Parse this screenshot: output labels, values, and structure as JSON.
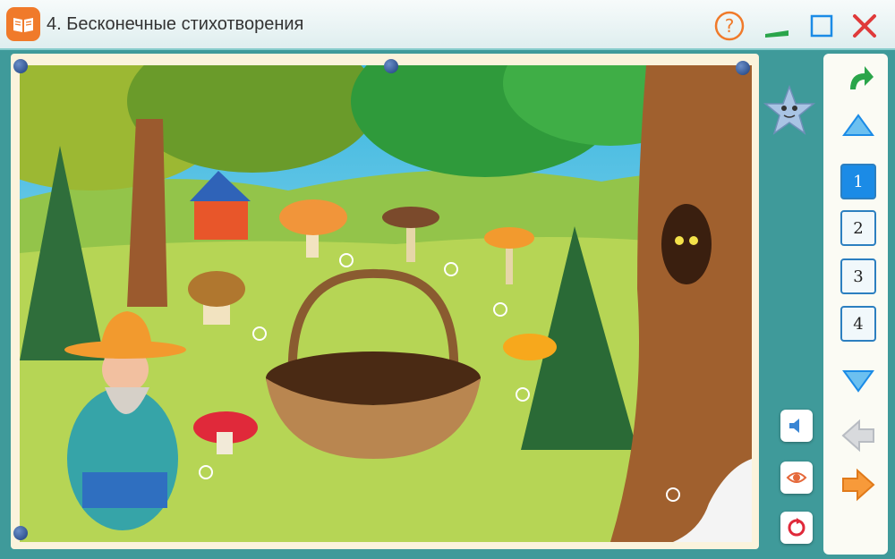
{
  "window": {
    "title": "4. Бесконечные стихотворения",
    "help_icon": "question-icon",
    "minimize_icon": "minimize-icon",
    "maximize_icon": "maximize-icon",
    "close_icon": "close-icon"
  },
  "pages": {
    "items": [
      "1",
      "2",
      "3",
      "4"
    ],
    "active_index": 0
  },
  "navigation": {
    "back_icon": "back-arrow-icon",
    "up_icon": "scroll-up-icon",
    "down_icon": "scroll-down-icon",
    "prev_icon": "previous-arrow-icon",
    "next_icon": "next-arrow-icon"
  },
  "tools": [
    "sound-icon",
    "eye-icon",
    "reload-icon"
  ],
  "colors": {
    "accent": "#f07a2a",
    "page_active": "#1b8be6",
    "frame": "#3f9a9a"
  }
}
